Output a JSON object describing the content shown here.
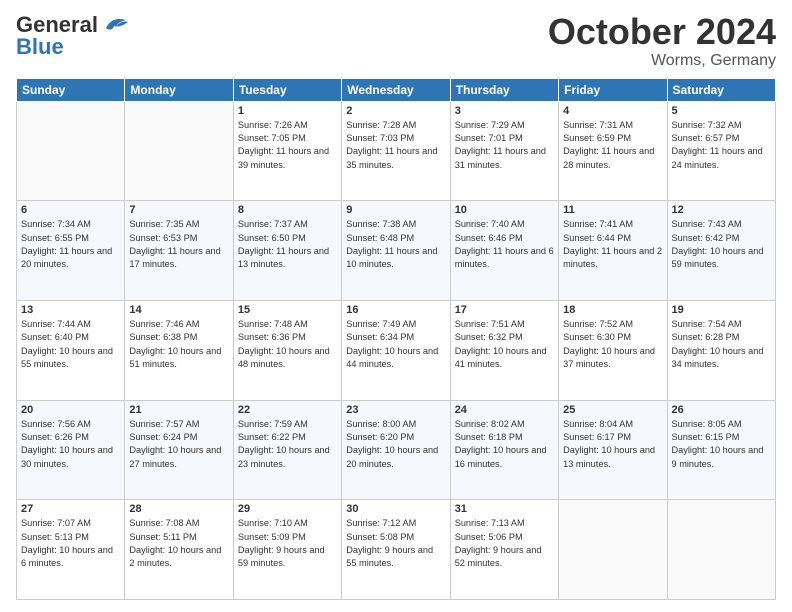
{
  "logo": {
    "line1": "General",
    "line2": "Blue"
  },
  "title": "October 2024",
  "location": "Worms, Germany",
  "days_header": [
    "Sunday",
    "Monday",
    "Tuesday",
    "Wednesday",
    "Thursday",
    "Friday",
    "Saturday"
  ],
  "weeks": [
    [
      {
        "day": "",
        "sunrise": "",
        "sunset": "",
        "daylight": ""
      },
      {
        "day": "",
        "sunrise": "",
        "sunset": "",
        "daylight": ""
      },
      {
        "day": "1",
        "sunrise": "Sunrise: 7:26 AM",
        "sunset": "Sunset: 7:05 PM",
        "daylight": "Daylight: 11 hours and 39 minutes."
      },
      {
        "day": "2",
        "sunrise": "Sunrise: 7:28 AM",
        "sunset": "Sunset: 7:03 PM",
        "daylight": "Daylight: 11 hours and 35 minutes."
      },
      {
        "day": "3",
        "sunrise": "Sunrise: 7:29 AM",
        "sunset": "Sunset: 7:01 PM",
        "daylight": "Daylight: 11 hours and 31 minutes."
      },
      {
        "day": "4",
        "sunrise": "Sunrise: 7:31 AM",
        "sunset": "Sunset: 6:59 PM",
        "daylight": "Daylight: 11 hours and 28 minutes."
      },
      {
        "day": "5",
        "sunrise": "Sunrise: 7:32 AM",
        "sunset": "Sunset: 6:57 PM",
        "daylight": "Daylight: 11 hours and 24 minutes."
      }
    ],
    [
      {
        "day": "6",
        "sunrise": "Sunrise: 7:34 AM",
        "sunset": "Sunset: 6:55 PM",
        "daylight": "Daylight: 11 hours and 20 minutes."
      },
      {
        "day": "7",
        "sunrise": "Sunrise: 7:35 AM",
        "sunset": "Sunset: 6:53 PM",
        "daylight": "Daylight: 11 hours and 17 minutes."
      },
      {
        "day": "8",
        "sunrise": "Sunrise: 7:37 AM",
        "sunset": "Sunset: 6:50 PM",
        "daylight": "Daylight: 11 hours and 13 minutes."
      },
      {
        "day": "9",
        "sunrise": "Sunrise: 7:38 AM",
        "sunset": "Sunset: 6:48 PM",
        "daylight": "Daylight: 11 hours and 10 minutes."
      },
      {
        "day": "10",
        "sunrise": "Sunrise: 7:40 AM",
        "sunset": "Sunset: 6:46 PM",
        "daylight": "Daylight: 11 hours and 6 minutes."
      },
      {
        "day": "11",
        "sunrise": "Sunrise: 7:41 AM",
        "sunset": "Sunset: 6:44 PM",
        "daylight": "Daylight: 11 hours and 2 minutes."
      },
      {
        "day": "12",
        "sunrise": "Sunrise: 7:43 AM",
        "sunset": "Sunset: 6:42 PM",
        "daylight": "Daylight: 10 hours and 59 minutes."
      }
    ],
    [
      {
        "day": "13",
        "sunrise": "Sunrise: 7:44 AM",
        "sunset": "Sunset: 6:40 PM",
        "daylight": "Daylight: 10 hours and 55 minutes."
      },
      {
        "day": "14",
        "sunrise": "Sunrise: 7:46 AM",
        "sunset": "Sunset: 6:38 PM",
        "daylight": "Daylight: 10 hours and 51 minutes."
      },
      {
        "day": "15",
        "sunrise": "Sunrise: 7:48 AM",
        "sunset": "Sunset: 6:36 PM",
        "daylight": "Daylight: 10 hours and 48 minutes."
      },
      {
        "day": "16",
        "sunrise": "Sunrise: 7:49 AM",
        "sunset": "Sunset: 6:34 PM",
        "daylight": "Daylight: 10 hours and 44 minutes."
      },
      {
        "day": "17",
        "sunrise": "Sunrise: 7:51 AM",
        "sunset": "Sunset: 6:32 PM",
        "daylight": "Daylight: 10 hours and 41 minutes."
      },
      {
        "day": "18",
        "sunrise": "Sunrise: 7:52 AM",
        "sunset": "Sunset: 6:30 PM",
        "daylight": "Daylight: 10 hours and 37 minutes."
      },
      {
        "day": "19",
        "sunrise": "Sunrise: 7:54 AM",
        "sunset": "Sunset: 6:28 PM",
        "daylight": "Daylight: 10 hours and 34 minutes."
      }
    ],
    [
      {
        "day": "20",
        "sunrise": "Sunrise: 7:56 AM",
        "sunset": "Sunset: 6:26 PM",
        "daylight": "Daylight: 10 hours and 30 minutes."
      },
      {
        "day": "21",
        "sunrise": "Sunrise: 7:57 AM",
        "sunset": "Sunset: 6:24 PM",
        "daylight": "Daylight: 10 hours and 27 minutes."
      },
      {
        "day": "22",
        "sunrise": "Sunrise: 7:59 AM",
        "sunset": "Sunset: 6:22 PM",
        "daylight": "Daylight: 10 hours and 23 minutes."
      },
      {
        "day": "23",
        "sunrise": "Sunrise: 8:00 AM",
        "sunset": "Sunset: 6:20 PM",
        "daylight": "Daylight: 10 hours and 20 minutes."
      },
      {
        "day": "24",
        "sunrise": "Sunrise: 8:02 AM",
        "sunset": "Sunset: 6:18 PM",
        "daylight": "Daylight: 10 hours and 16 minutes."
      },
      {
        "day": "25",
        "sunrise": "Sunrise: 8:04 AM",
        "sunset": "Sunset: 6:17 PM",
        "daylight": "Daylight: 10 hours and 13 minutes."
      },
      {
        "day": "26",
        "sunrise": "Sunrise: 8:05 AM",
        "sunset": "Sunset: 6:15 PM",
        "daylight": "Daylight: 10 hours and 9 minutes."
      }
    ],
    [
      {
        "day": "27",
        "sunrise": "Sunrise: 7:07 AM",
        "sunset": "Sunset: 5:13 PM",
        "daylight": "Daylight: 10 hours and 6 minutes."
      },
      {
        "day": "28",
        "sunrise": "Sunrise: 7:08 AM",
        "sunset": "Sunset: 5:11 PM",
        "daylight": "Daylight: 10 hours and 2 minutes."
      },
      {
        "day": "29",
        "sunrise": "Sunrise: 7:10 AM",
        "sunset": "Sunset: 5:09 PM",
        "daylight": "Daylight: 9 hours and 59 minutes."
      },
      {
        "day": "30",
        "sunrise": "Sunrise: 7:12 AM",
        "sunset": "Sunset: 5:08 PM",
        "daylight": "Daylight: 9 hours and 55 minutes."
      },
      {
        "day": "31",
        "sunrise": "Sunrise: 7:13 AM",
        "sunset": "Sunset: 5:06 PM",
        "daylight": "Daylight: 9 hours and 52 minutes."
      },
      {
        "day": "",
        "sunrise": "",
        "sunset": "",
        "daylight": ""
      },
      {
        "day": "",
        "sunrise": "",
        "sunset": "",
        "daylight": ""
      }
    ]
  ]
}
